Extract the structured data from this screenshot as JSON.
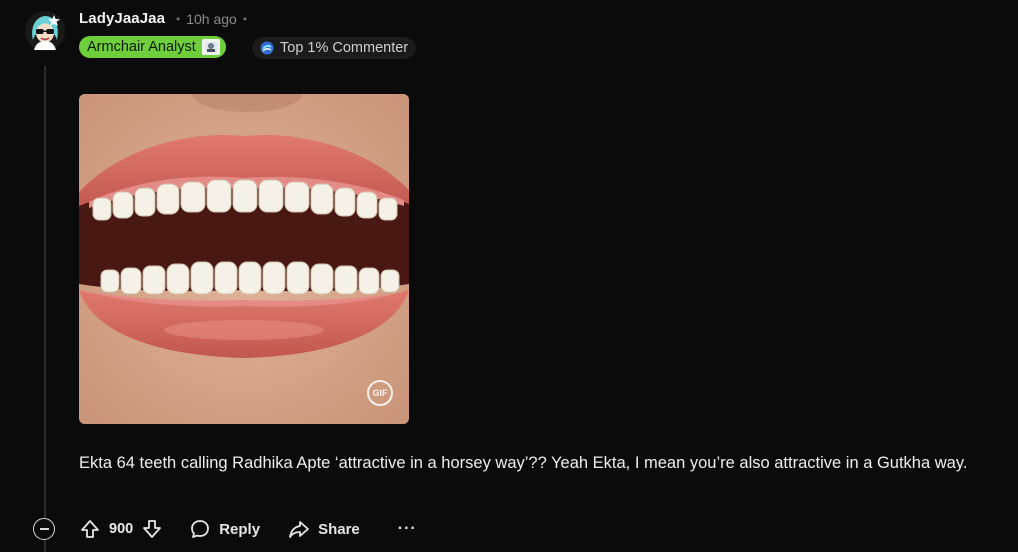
{
  "comment": {
    "author": "LadyJaaJaa",
    "time": "10h ago",
    "flair": {
      "label": "Armchair Analyst",
      "color": "#6fce3c"
    },
    "badge": {
      "label": "Top 1% Commenter"
    },
    "media": {
      "type_label": "GIF"
    },
    "body": "Ekta 64 teeth calling Radhika Apte ‘attractive in a horsey way’?? Yeah Ekta, I mean you’re also attractive in a Gutkha way.",
    "actions": {
      "score": "900",
      "reply_label": "Reply",
      "share_label": "Share",
      "more_label": "···"
    }
  },
  "icons": {
    "collapse": "minus-circle-icon",
    "upvote": "arrow-up-icon",
    "downvote": "arrow-down-icon",
    "reply": "chat-bubble-icon",
    "share": "share-arrow-icon",
    "badge": "commenter-badge-icon"
  }
}
